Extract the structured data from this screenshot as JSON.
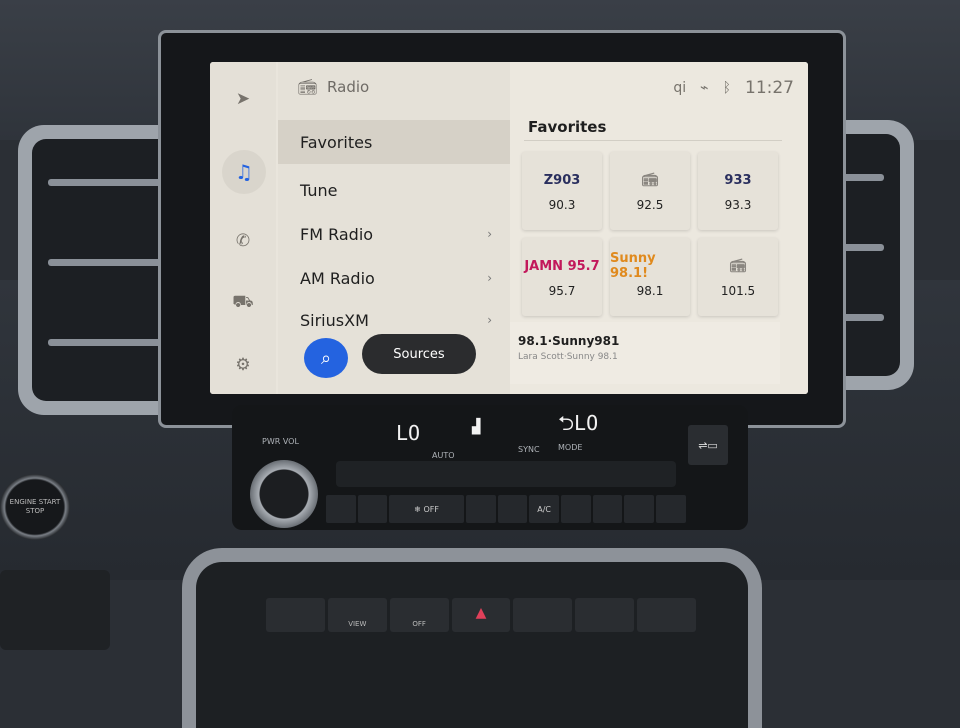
{
  "screen": {
    "rail": {
      "icons": [
        "navigation-icon",
        "music-icon",
        "phone-icon",
        "car-icon",
        "settings-icon"
      ],
      "active": "music-icon"
    },
    "menu": {
      "title": "Radio",
      "items": [
        {
          "label": "Favorites",
          "selected": true,
          "chevron": false
        },
        {
          "label": "Tune",
          "chevron": false
        },
        {
          "label": "FM Radio",
          "chevron": true
        },
        {
          "label": "AM Radio",
          "chevron": true
        },
        {
          "label": "SiriusXM",
          "chevron": true
        }
      ],
      "sources_label": "Sources"
    },
    "status": {
      "time": "11:27",
      "icons": [
        "qi-wireless-charging-icon",
        "voice-off-icon",
        "bluetooth-icon"
      ]
    },
    "favorites": {
      "title": "Favorites",
      "stations": [
        {
          "freq": "90.3",
          "logo": "Z903",
          "logo_color": "#2a2f5e"
        },
        {
          "freq": "92.5",
          "logo": "",
          "logo_color": "#8a8680"
        },
        {
          "freq": "93.3",
          "logo": "933",
          "logo_color": "#2a2f5e"
        },
        {
          "freq": "95.7",
          "logo": "JAMN 95.7",
          "logo_color": "#c2185b"
        },
        {
          "freq": "98.1",
          "logo": "Sunny 98.1!",
          "logo_color": "#e08a1e"
        },
        {
          "freq": "101.5",
          "logo": "",
          "logo_color": "#8a8680"
        }
      ]
    },
    "now_playing": {
      "station": "98.1·Sunny981",
      "info": "Lara Scott·Sunny 98.1"
    },
    "accent": "#2463e0"
  },
  "climate": {
    "left_temp": "LO",
    "right_temp": "LO",
    "sync_tag": "SYNC",
    "labels": {
      "pwr_vol": "PWR VOL",
      "auto": "AUTO",
      "sync": "SYNC",
      "mode": "MODE"
    },
    "buttons": [
      "",
      "",
      "❄ OFF",
      "",
      "",
      "A/C",
      "",
      "",
      "",
      ""
    ]
  },
  "engine_button": "ENGINE START STOP",
  "console_buttons": [
    "",
    "VIEW",
    "OFF",
    "▲",
    "",
    "",
    ""
  ]
}
